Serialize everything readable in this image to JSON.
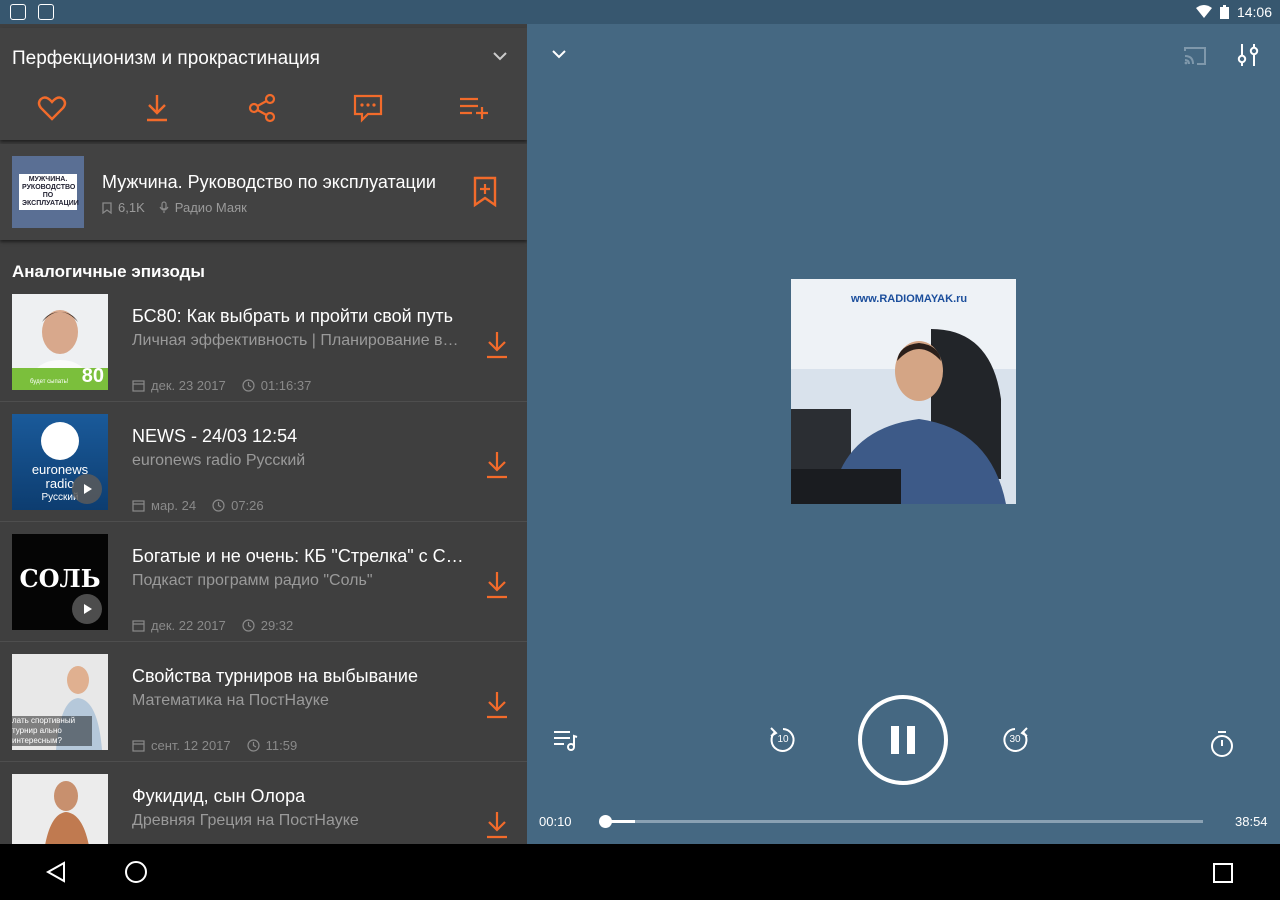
{
  "status_bar": {
    "time": "14:06"
  },
  "header": {
    "title": "Перфекционизм и прокрастинация"
  },
  "podcast": {
    "title": "Мужчина. Руководство по эксплуатации",
    "subscribers": "6,1K",
    "author": "Радио Маяк",
    "thumb_text": "МУЖЧИНА. РУКОВОДСТВО ПО ЭКСПЛУАТАЦИИ"
  },
  "similar": {
    "section_title": "Аналогичные эпизоды",
    "episodes": [
      {
        "title": "БС80: Как выбрать и пройти свой путь",
        "subtitle": "Личная эффективность | Планирование времени",
        "date": "дек. 23 2017",
        "duration": "01:16:37",
        "thumb_badge": "80",
        "thumb_caption": "будет сыпать!"
      },
      {
        "title": "NEWS - 24/03 12:54",
        "subtitle": "euronews radio Русский",
        "date": "мар. 24",
        "duration": "07:26",
        "thumb_line1": "euronews",
        "thumb_line2": "radio",
        "thumb_line3": "Русский"
      },
      {
        "title": "Богатые и не очень: КБ \"Стрелка\" с Сергеем",
        "subtitle": "Подкаст программ радио \"Соль\"",
        "date": "дек. 22 2017",
        "duration": "29:32",
        "thumb_logo": "СОЛЬ"
      },
      {
        "title": "Свойства турниров на выбывание",
        "subtitle": "Математика на ПостНауке",
        "date": "сент. 12 2017",
        "duration": "11:59",
        "thumb_caption": "лать спортивный турнир ально интересным?"
      },
      {
        "title": "Фукидид, сын Олора",
        "subtitle": "Древняя Греция на ПостНауке",
        "date": "",
        "duration": ""
      }
    ]
  },
  "player": {
    "cover_banner": "www.RADIOMAYAK.ru",
    "rewind_seconds": "10",
    "forward_seconds": "30",
    "elapsed": "00:10",
    "total": "38:54",
    "progress": 0.0043
  },
  "colors": {
    "accent": "#f26b2b",
    "panel": "#3f3f3f",
    "player_bg": "#456882"
  }
}
